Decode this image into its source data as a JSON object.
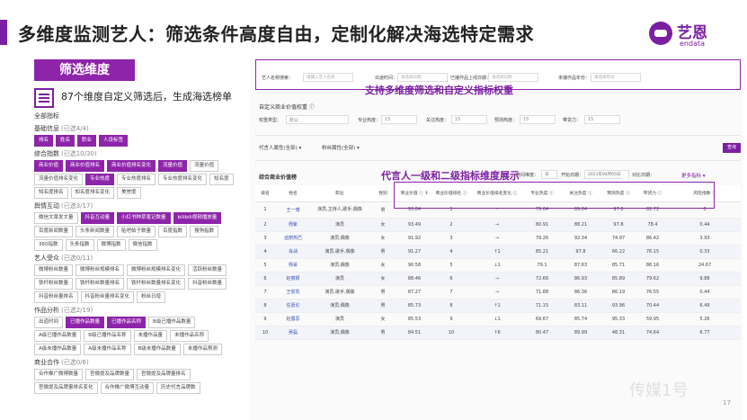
{
  "header": {
    "title": "多维度监测艺人：筛选条件高度自由，定制化解决海选特定需求",
    "logo_cn": "艺恩",
    "logo_en": "endata"
  },
  "left": {
    "title": "筛选维度",
    "desc": "87个维度自定义筛选后，生成海选榜单",
    "all": "全部指标",
    "groups": [
      {
        "name": "基础信息",
        "count": "(已选4/4)",
        "tags": [
          {
            "t": "排名",
            "on": true
          },
          {
            "t": "姓名",
            "on": true
          },
          {
            "t": "职业",
            "on": true
          },
          {
            "t": "人设标签",
            "on": true
          }
        ]
      },
      {
        "name": "综合指数",
        "count": "(已选10/30)",
        "tags": [
          {
            "t": "商业价值",
            "on": true
          },
          {
            "t": "商业价值排名",
            "on": true
          },
          {
            "t": "商业价值排名变化",
            "on": true
          },
          {
            "t": "流量价值",
            "on": true
          },
          {
            "t": "流量价值",
            "on": false
          },
          {
            "t": "流量价值排名变化",
            "on": false
          },
          {
            "t": "专业热度",
            "on": true
          },
          {
            "t": "专业热度排名",
            "on": false
          },
          {
            "t": "专业热度排名变化",
            "on": false
          },
          {
            "t": "知名度",
            "on": false
          },
          {
            "t": "知名度排名",
            "on": false
          },
          {
            "t": "知名度排名变化",
            "on": false
          },
          {
            "t": "美誉度",
            "on": false
          }
        ]
      },
      {
        "name": "舆情互动",
        "count": "(已选3/17)",
        "tags": [
          {
            "t": "微信文章发文量",
            "on": false
          },
          {
            "t": "抖音互动量",
            "on": true
          },
          {
            "t": "小红书种草笔记数量",
            "on": true
          },
          {
            "t": "bilibili视频播放量",
            "on": true
          },
          {
            "t": "百度新闻数量",
            "on": false
          },
          {
            "t": "头条新闻数量",
            "on": false
          },
          {
            "t": "贴吧帖子数量",
            "on": false
          },
          {
            "t": "百度指数",
            "on": false
          },
          {
            "t": "搜狗指数",
            "on": false
          },
          {
            "t": "360指数",
            "on": false
          },
          {
            "t": "头条指数",
            "on": false
          },
          {
            "t": "微博指数",
            "on": false
          },
          {
            "t": "微信指数",
            "on": false
          }
        ]
      },
      {
        "name": "艺人受众",
        "count": "(已选0/11)",
        "tags": [
          {
            "t": "微博粉丝数量",
            "on": false
          },
          {
            "t": "微博粉丝规模排名",
            "on": false
          },
          {
            "t": "微博粉丝规模排名变化",
            "on": false
          },
          {
            "t": "活跃粉丝数量",
            "on": false
          },
          {
            "t": "铁杆粉丝数量",
            "on": false
          },
          {
            "t": "铁杆粉丝数量排名",
            "on": false
          },
          {
            "t": "铁杆粉丝数量排名变化",
            "on": false
          },
          {
            "t": "抖音粉丝数量",
            "on": false
          },
          {
            "t": "抖音粉丝量排名",
            "on": false
          },
          {
            "t": "抖音粉丝量排名变化",
            "on": false
          },
          {
            "t": "粉丝日增",
            "on": false
          }
        ]
      },
      {
        "name": "作品分析",
        "count": "(已选2/19)",
        "tags": [
          {
            "t": "出道时间",
            "on": false
          },
          {
            "t": "已播作品数量",
            "on": true
          },
          {
            "t": "已播作品名称",
            "on": true
          },
          {
            "t": "B级已播作品数量",
            "on": false
          },
          {
            "t": "A级已播作品数量",
            "on": false
          },
          {
            "t": "B级已播作品名称",
            "on": false
          },
          {
            "t": "未播作品量",
            "on": false
          },
          {
            "t": "未播作品名称",
            "on": false
          },
          {
            "t": "A级未播作品数量",
            "on": false
          },
          {
            "t": "A级未播作品名称",
            "on": false
          },
          {
            "t": "B级未播作品数量",
            "on": false
          },
          {
            "t": "未播作品预测",
            "on": false
          }
        ]
      },
      {
        "name": "商业合作",
        "count": "(已选0/6)",
        "tags": [
          {
            "t": "合作推广微博数量",
            "on": false
          },
          {
            "t": "官微提及品牌数量",
            "on": false
          },
          {
            "t": "官微提及品牌量排名",
            "on": false
          },
          {
            "t": "官微提及品牌量排名变化",
            "on": false
          },
          {
            "t": "合作推广微博互动量",
            "on": false
          },
          {
            "t": "历史代言品牌数",
            "on": false
          }
        ]
      }
    ]
  },
  "filter": {
    "fields": [
      {
        "label": "艺人名称搜索：",
        "ph": "请输入艺人名称"
      },
      {
        "label": "出道时间：",
        "ph": "请选择日期"
      },
      {
        "label": "已播作品上线日期：",
        "ph": "请选择日期"
      },
      {
        "label": "未播作品年份：",
        "ph": "请选择年份"
      }
    ],
    "callout": "支持多维度筛选和自定义指标权重"
  },
  "weight": {
    "title": "自定义商业价值权重",
    "type_label": "权重类型：",
    "type_val": "默认",
    "items": [
      {
        "l": "专业热度：",
        "v": "15"
      },
      {
        "l": "关注热度：",
        "v": "15"
      },
      {
        "l": "预测热度：",
        "v": "15"
      },
      {
        "l": "带货力：",
        "v": "15"
      }
    ]
  },
  "attrs": {
    "a1": "代言人属性(全部) ▾",
    "a2": "粉丝属性(全部) ▾",
    "query": "查询"
  },
  "table": {
    "title": "综合商业价值榜",
    "callout": "代言人一级和二级指标维度展示",
    "dim": "时间维度：",
    "dim_val": "日",
    "start_l": "开始日期：",
    "start": "2021年04月05日",
    "end_l": "对比日期：",
    "end": "2021年04月04日",
    "more": "更多指标 ▾",
    "headers": [
      "排名",
      "姓名",
      "职业",
      "性别",
      "商业价值 ⓘ ⇕",
      "商业价值排名 ⓘ",
      "商业价值排名变化 ⓘ",
      "专业热度 ⓘ",
      "关注热度 ⓘ",
      "预测热度 ⓘ",
      "带货力 ⓘ",
      "风险指数 ⓘ"
    ],
    "rows": [
      [
        "1",
        "王一博",
        "演员,主持人,歌手,偶像",
        "男",
        "93.84",
        "1",
        "-",
        "79.64",
        "89.84",
        "97.8",
        "82.72",
        "0"
      ],
      [
        "2",
        "杨紫",
        "演员",
        "女",
        "93.49",
        "2",
        "→",
        "80.91",
        "88.21",
        "97.8",
        "78.4",
        "0.44"
      ],
      [
        "3",
        "迪丽热巴",
        "演员,偶像",
        "女",
        "91.92",
        "3",
        "→",
        "79.26",
        "92.34",
        "74.97",
        "86.42",
        "3.93"
      ],
      [
        "4",
        "肖战",
        "演员,歌手,偶像",
        "男",
        "91.27",
        "4",
        "↑1",
        "85.21",
        "97.8",
        "66.22",
        "76.15",
        "0.33"
      ],
      [
        "5",
        "杨幂",
        "演员,偶像",
        "女",
        "90.58",
        "5",
        "↓1",
        "79.1",
        "87.63",
        "85.71",
        "86.16",
        "24.67"
      ],
      [
        "6",
        "赵丽颖",
        "演员",
        "女",
        "88.46",
        "6",
        "→",
        "72.66",
        "86.93",
        "85.89",
        "79.62",
        "9.88"
      ],
      [
        "7",
        "王俊凯",
        "演员,歌手,偶像",
        "男",
        "87.27",
        "7",
        "→",
        "71.88",
        "86.36",
        "86.19",
        "76.55",
        "0.44"
      ],
      [
        "8",
        "任嘉伦",
        "演员,偶像",
        "男",
        "85.73",
        "8",
        "↑1",
        "71.15",
        "83.11",
        "93.96",
        "70.44",
        "6.49"
      ],
      [
        "9",
        "赵露思",
        "演员",
        "女",
        "85.53",
        "9",
        "↓1",
        "69.67",
        "85.74",
        "95.33",
        "59.95",
        "5.26"
      ],
      [
        "10",
        "吴磊",
        "演员,偶像",
        "男",
        "84.51",
        "10",
        "↑6",
        "80.47",
        "89.99",
        "48.31",
        "74.64",
        "6.77"
      ]
    ]
  },
  "watermark": "传媒1号",
  "watermark_small": "17"
}
